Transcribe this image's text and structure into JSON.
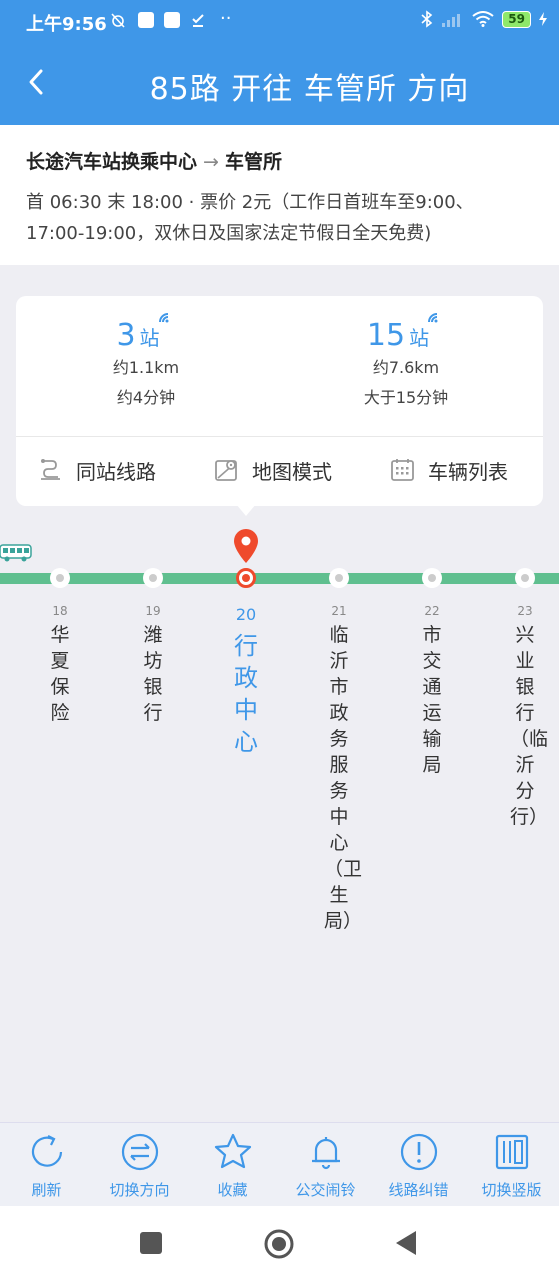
{
  "status": {
    "time": "上午9:56",
    "dots": "··",
    "battery": "59"
  },
  "header": {
    "title": "85路 开往 车管所 方向"
  },
  "route": {
    "from": "长途汽车站换乘中心",
    "arrow": "→",
    "to": "车管所",
    "desc": "首 06:30 末 18:00 · 票价 2元（工作日首班车至9:00、17:00-19:00，双休日及国家法定节假日全天免费)"
  },
  "arrivals": [
    {
      "stops": "3",
      "unit": "站",
      "distance": "约1.1km",
      "time": "约4分钟"
    },
    {
      "stops": "15",
      "unit": "站",
      "distance": "约7.6km",
      "time": "大于15分钟"
    }
  ],
  "actions": {
    "same_station": "同站线路",
    "map_mode": "地图模式",
    "vehicle_list": "车辆列表"
  },
  "stations": [
    {
      "num": "18",
      "name": "华夏保险"
    },
    {
      "num": "19",
      "name": "潍坊银行"
    },
    {
      "num": "20",
      "name": "行政中心"
    },
    {
      "num": "21",
      "name": "临沂市政务服务中心（卫生局）"
    },
    {
      "num": "22",
      "name": "市交通运输局"
    },
    {
      "num": "23",
      "name": "兴业银行（临沂分行）"
    }
  ],
  "toolbar": {
    "refresh": "刷新",
    "switch_direction": "切换方向",
    "favorite": "收藏",
    "alarm": "公交闹铃",
    "report_error": "线路纠错",
    "vertical": "切换竖版"
  },
  "colors": {
    "primary": "#3f97e8",
    "line": "#5fbf8f",
    "current": "#ef4a2c"
  }
}
